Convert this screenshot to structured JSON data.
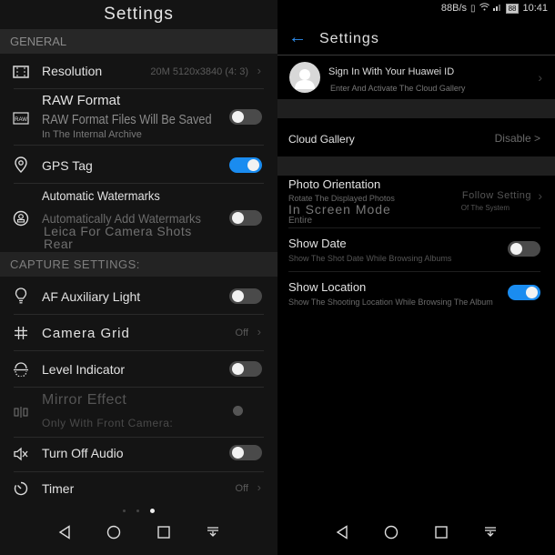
{
  "camera_settings": {
    "title": "Settings",
    "sections": [
      {
        "header": "GENERAL"
      },
      {
        "header": "CAPTURE SETTINGS:"
      }
    ],
    "items": [
      {
        "label": "Resolution",
        "icon": "resolution-icon",
        "value": "20M 5120x3840 (4: 3)",
        "type": "link"
      },
      {
        "label": "RAW Format",
        "icon": "raw-icon",
        "subtitle_large": "RAW Format Files Will Be Saved",
        "subtitle": "In The Internal Archive",
        "type": "toggle",
        "on": false
      },
      {
        "label": "GPS Tag",
        "icon": "location-pin-icon",
        "type": "toggle",
        "on": true
      },
      {
        "label": "Automatic Watermarks",
        "icon": "watermark-icon",
        "subtitle": "Automatically Add Watermarks",
        "subtitle_large": "Leica For Camera Shots",
        "subtitle_large_2": "Rear",
        "type": "toggle",
        "on": false
      },
      {
        "label": "AF Auxiliary Light",
        "icon": "bulb-icon",
        "type": "toggle",
        "on": false
      },
      {
        "label": "Camera Grid",
        "icon": "grid-icon",
        "value": "Off",
        "type": "link"
      },
      {
        "label": "Level Indicator",
        "icon": "level-icon",
        "type": "toggle",
        "on": false
      },
      {
        "label": "Mirror Effect",
        "icon": "mirror-icon",
        "subtitle": "Only With Front Camera:",
        "type": "toggle-disabled",
        "on": false
      },
      {
        "label": "Turn Off Audio",
        "icon": "mute-icon",
        "type": "toggle",
        "on": false
      },
      {
        "label": "Timer",
        "icon": "timer-icon",
        "value": "Off",
        "type": "link"
      }
    ],
    "page_indicator": {
      "count": 3,
      "active": 3
    }
  },
  "gallery_settings": {
    "status_bar": {
      "speed": "88B/s",
      "battery": "88",
      "time": "10:41"
    },
    "title": "Settings",
    "profile": {
      "name": "Sign In With Your Huawei ID",
      "subtitle": "Enter And Activate The Cloud Gallery"
    },
    "cloud_gallery": {
      "label": "Cloud Gallery",
      "value": "Disable >"
    },
    "photo_orientation": {
      "label": "Photo Orientation",
      "subtitle": "Rotate The Displayed Photos",
      "subtitle_large": "In Screen Mode",
      "subtitle_2": "Entire",
      "value": "Follow Setting",
      "value_sub": "Of The System"
    },
    "show_date": {
      "label": "Show Date",
      "subtitle": "Show The Shot Date While Browsing Albums",
      "on": false
    },
    "show_location": {
      "label": "Show Location",
      "subtitle": "Show The Shooting Location While Browsing The Album",
      "on": true
    }
  },
  "colors": {
    "accent": "#1a8cf0",
    "toggle_off": "#4a4a4a",
    "section_bg": "#272727"
  }
}
